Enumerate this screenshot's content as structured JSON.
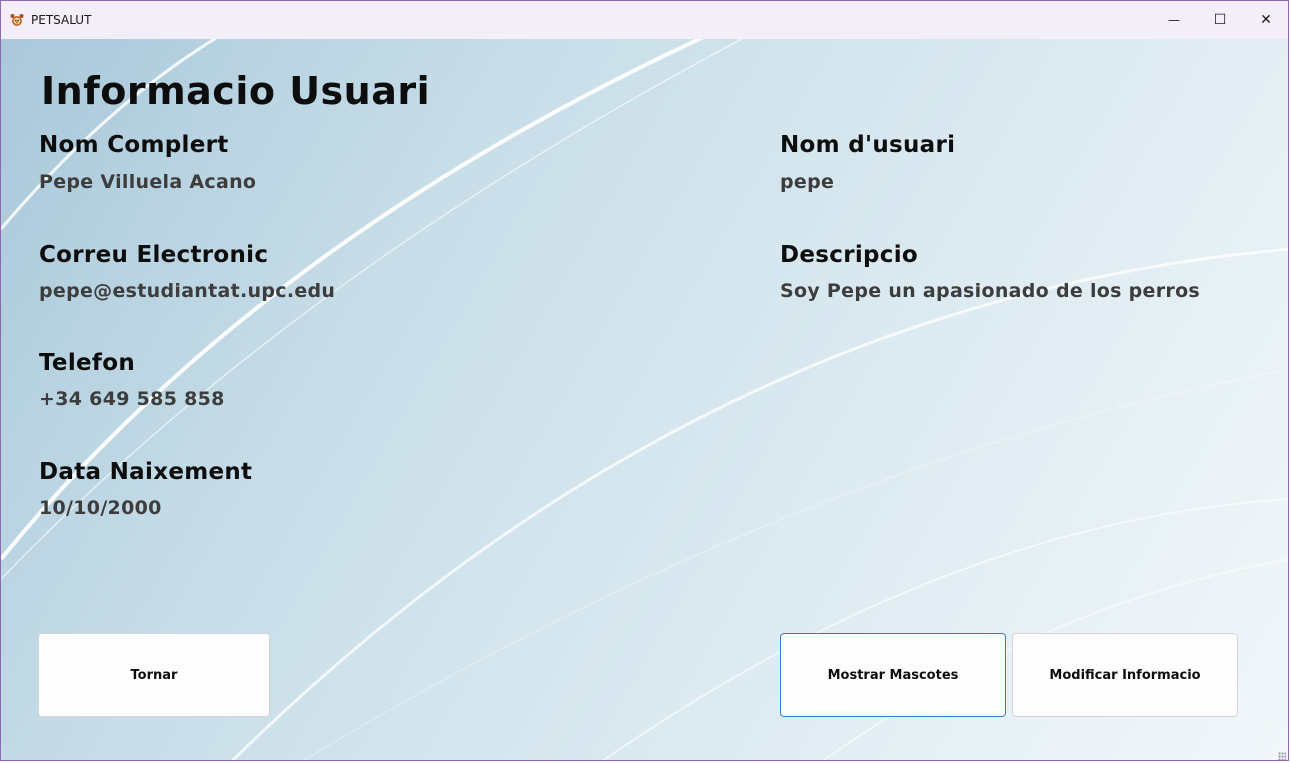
{
  "window": {
    "title": "PETSALUT",
    "app_icon": "paw-logo-icon",
    "controls": {
      "minimize_glyph": "—",
      "maximize_glyph": "☐",
      "close_glyph": "✕"
    }
  },
  "page": {
    "heading": "Informacio Usuari",
    "fields": {
      "full_name": {
        "label": "Nom Complert",
        "value": "Pepe Villuela Acano"
      },
      "username": {
        "label": "Nom d'usuari",
        "value": "pepe"
      },
      "email": {
        "label": "Correu Electronic",
        "value": "pepe@estudiantat.upc.edu"
      },
      "description": {
        "label": "Descripcio",
        "value": "Soy Pepe un apasionado de los perros"
      },
      "phone": {
        "label": "Telefon",
        "value": "+34 649 585 858"
      },
      "birth_date": {
        "label": "Data Naixement",
        "value": "10/10/2000"
      }
    }
  },
  "buttons": {
    "back": "Tornar",
    "show_pets": "Mostrar Mascotes",
    "modify_info": "Modificar Informacio"
  },
  "colors": {
    "accent_border": "#3a7bc8",
    "title_bar": "#f3eef8",
    "window_border": "#8a6bb0"
  }
}
